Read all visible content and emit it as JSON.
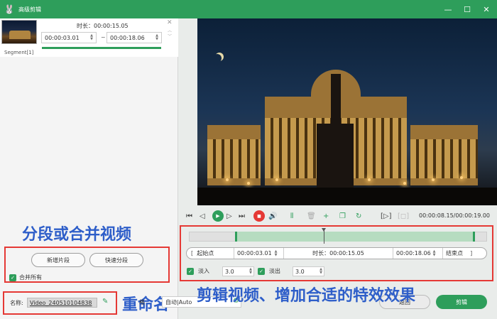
{
  "window": {
    "title": "高级剪辑",
    "accent": "#2e9e5b",
    "controls": [
      "—",
      "☐",
      "✕"
    ]
  },
  "segment_list": {
    "duration_label": "时长：00:00:15.05",
    "start": "00:00:03.01",
    "separator": "~",
    "end": "00:00:18.06",
    "segment_label": "Segment[1]"
  },
  "annotations": {
    "split_merge": "分段或合并视频",
    "rename": "重命名",
    "trim_effects": "剪辑视频、增加合适的特效效果",
    "color": "#2e5ec9",
    "box_color": "#e53935"
  },
  "split_panel": {
    "new_segment": "新增片段",
    "quick_split": "快速分段",
    "merge_all": "合并所有",
    "merge_all_checked": true
  },
  "rename_panel": {
    "label": "名称:",
    "value": "Video_240510104838",
    "edit_icon": "pencil-icon"
  },
  "playback": {
    "time_readout": "00:00:08.15/00:00:19.00",
    "playhead_position": 0.447
  },
  "trim": {
    "start_button": "起始点",
    "start_time": "00:00:03.01",
    "duration": "时长：00:00:15.05",
    "end_time": "00:00:18.06",
    "end_button": "结束点",
    "fade_in_label": "淡入",
    "fade_in_value": "3.0",
    "fade_in_checked": true,
    "fade_out_label": "淡出",
    "fade_out_value": "3.0",
    "fade_out_checked": true
  },
  "bottom_bar": {
    "partial_label_1": "格",
    "audio_value": "自动|Auto",
    "back_button": "返回",
    "trim_button": "剪辑"
  }
}
